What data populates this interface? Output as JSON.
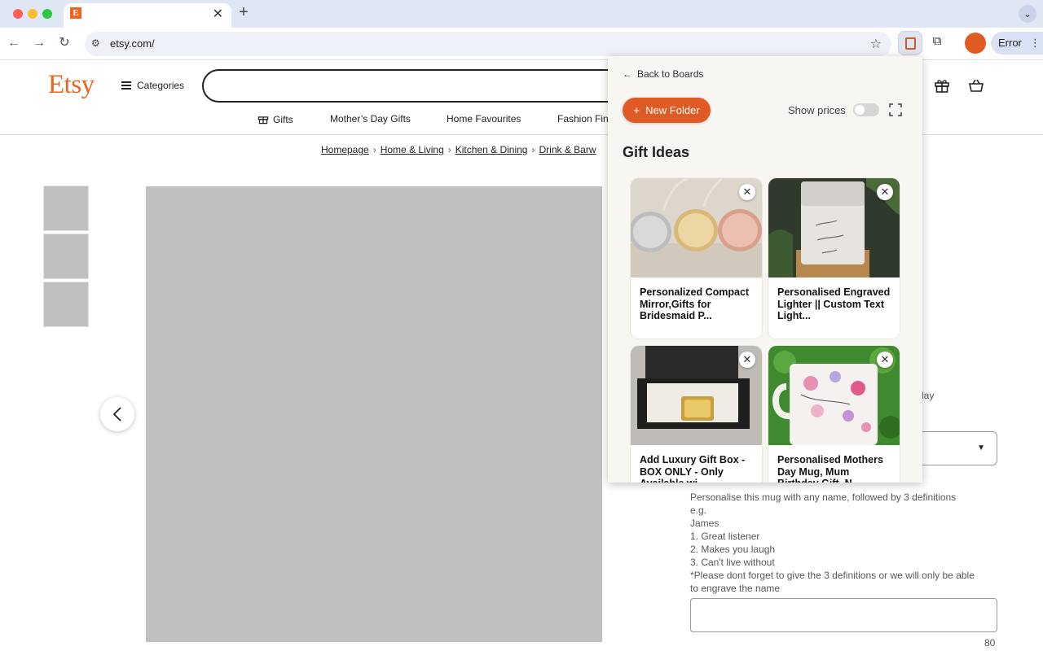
{
  "browser": {
    "tab_favicon": "E",
    "tab_close": "✕",
    "new_tab": "+",
    "url": "etsy.com/",
    "profile_status": "Error",
    "menu_dots": "⋮",
    "icons": [
      "back-arrow-icon",
      "forward-arrow-icon",
      "reload-icon",
      "site-settings-icon",
      "star-icon",
      "bookmark-extension-icon",
      "puzzle-icon",
      "chevron-down-icon"
    ]
  },
  "header": {
    "logo": "Etsy",
    "categories": "Categories",
    "search_value": ""
  },
  "subnav": {
    "items": [
      "Gifts",
      "Mother’s Day Gifts",
      "Home Favourites",
      "Fashion Fin"
    ]
  },
  "breadcrumb": {
    "items": [
      "Homepage",
      "Home & Living",
      "Kitchen & Dining",
      "Drink & Barw"
    ]
  },
  "listing": {
    "thumbnail_count": 3,
    "right_fragments": [
      "lay"
    ],
    "personalisation": {
      "lines": [
        "Personalise this mug with any name, followed by 3 definitions",
        "e.g.",
        "James",
        "1. Great listener",
        "2. Makes you laugh",
        "3. Can't live without",
        "*Please dont forget to give the 3 definitions or we will only be able",
        "to engrave the name"
      ],
      "char_count": "80"
    }
  },
  "popup": {
    "back_label": "Back to Boards",
    "new_folder_label": "New Folder",
    "show_prices_label": "Show prices",
    "show_prices_on": false,
    "board_title": "Gift Ideas",
    "items": [
      {
        "title": "Personalized Compact Mirror,Gifts for Bridesmaid P...",
        "remove": "✕"
      },
      {
        "title": "Personalised Engraved Lighter || Custom Text Light...",
        "remove": "✕"
      },
      {
        "title": "Add Luxury Gift Box - BOX ONLY - Only Available wi...",
        "remove": "✕"
      },
      {
        "title": "Personalised Mothers Day Mug, Mum Birthday Gift, N...",
        "remove": "✕"
      }
    ]
  },
  "colors": {
    "brand": "#f1641e",
    "extension_accent": "#e05a24",
    "placeholder_image": "#c0c0c0"
  }
}
